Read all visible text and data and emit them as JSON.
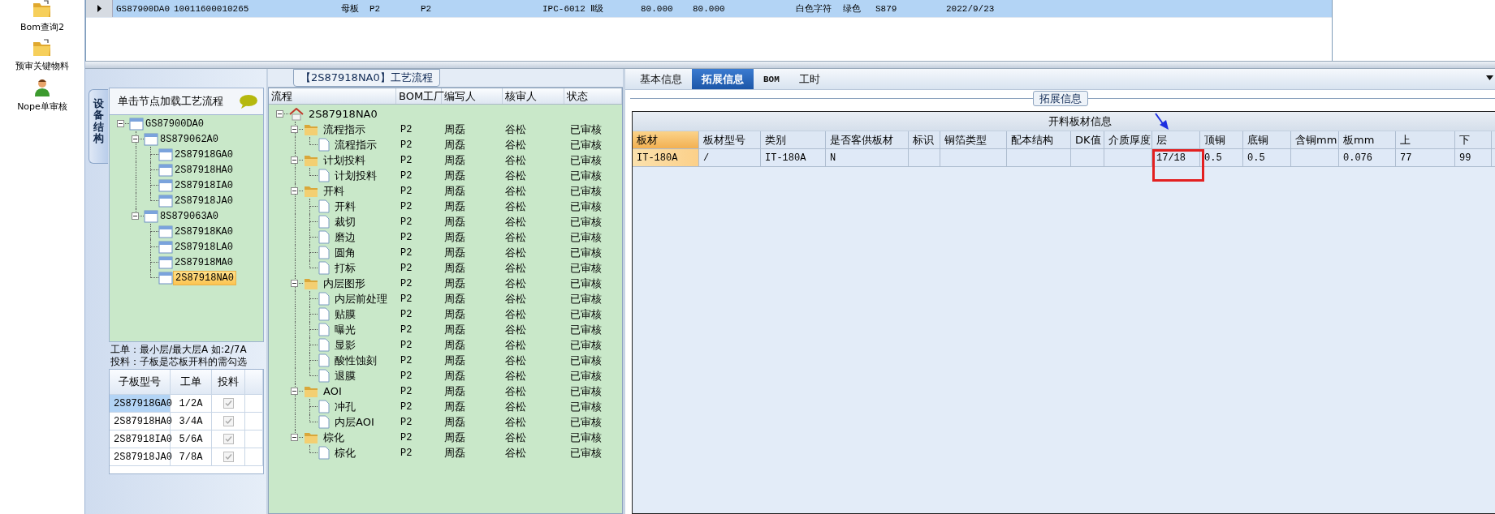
{
  "sidebar": {
    "items": [
      {
        "label": "Bom查询2",
        "kind": "folder"
      },
      {
        "label": "预审关键物料",
        "kind": "folder"
      },
      {
        "label": "Nope单审核",
        "kind": "person"
      }
    ]
  },
  "top_grid": {
    "rows": [
      {
        "selected": true,
        "cells": [
          "GS87900DA0",
          "10011600010265",
          "母板",
          "P2",
          "P2",
          "IPC-6012 Ⅱ级",
          "80.000",
          "80.000",
          "白色字符",
          "绿色",
          "S879",
          "2022/9/23"
        ]
      }
    ]
  },
  "structure_panel": {
    "vertical_tab": "设备结构",
    "hint": "单击节点加载工艺流程",
    "tree": [
      {
        "label": "GS87900DA0",
        "expanded": true,
        "selected": false,
        "children": [
          {
            "label": "8S879062A0",
            "expanded": true,
            "selected": false,
            "children": [
              {
                "label": "2S87918GA0",
                "selected": false
              },
              {
                "label": "2S87918HA0",
                "selected": false
              },
              {
                "label": "2S87918IA0",
                "selected": false
              },
              {
                "label": "2S87918JA0",
                "selected": false
              }
            ]
          },
          {
            "label": "8S879063A0",
            "expanded": true,
            "selected": false,
            "children": [
              {
                "label": "2S87918KA0",
                "selected": false
              },
              {
                "label": "2S87918LA0",
                "selected": false
              },
              {
                "label": "2S87918MA0",
                "selected": false
              },
              {
                "label": "2S87918NA0",
                "selected": true
              }
            ]
          }
        ]
      }
    ],
    "notes": [
      "工单：最小层/最大层A 如:2/7A",
      "投料：子板是芯板开料的需勾选"
    ],
    "table": {
      "columns": [
        "子板型号",
        "工单",
        "投料"
      ],
      "rows": [
        {
          "board": "2S87918GA0",
          "order": "1/2A",
          "checked": true,
          "selected": true
        },
        {
          "board": "2S87918HA0",
          "order": "3/4A",
          "checked": true,
          "selected": false
        },
        {
          "board": "2S87918IA0",
          "order": "5/6A",
          "checked": true,
          "selected": false
        },
        {
          "board": "2S87918JA0",
          "order": "7/8A",
          "checked": true,
          "selected": false
        }
      ]
    }
  },
  "process_panel": {
    "title": "【2S87918NA0】工艺流程",
    "columns": [
      "流程",
      "BOM工厂",
      "编写人",
      "核审人",
      "状态"
    ],
    "tree": [
      {
        "label": "2S87918NA0",
        "kind": "root",
        "expanded": true,
        "children": [
          {
            "label": "流程指示",
            "kind": "group",
            "expanded": true,
            "factory": "P2",
            "writer": "周磊",
            "reviewer": "谷松",
            "status": "已审核",
            "children": [
              {
                "label": "流程指示",
                "kind": "step",
                "factory": "P2",
                "writer": "周磊",
                "reviewer": "谷松",
                "status": "已审核"
              }
            ]
          },
          {
            "label": "计划投料",
            "kind": "group",
            "expanded": true,
            "factory": "P2",
            "writer": "周磊",
            "reviewer": "谷松",
            "status": "已审核",
            "children": [
              {
                "label": "计划投料",
                "kind": "step",
                "factory": "P2",
                "writer": "周磊",
                "reviewer": "谷松",
                "status": "已审核"
              }
            ]
          },
          {
            "label": "开料",
            "kind": "group",
            "expanded": true,
            "factory": "P2",
            "writer": "周磊",
            "reviewer": "谷松",
            "status": "已审核",
            "children": [
              {
                "label": "开料",
                "kind": "step",
                "factory": "P2",
                "writer": "周磊",
                "reviewer": "谷松",
                "status": "已审核"
              },
              {
                "label": "裁切",
                "kind": "step",
                "factory": "P2",
                "writer": "周磊",
                "reviewer": "谷松",
                "status": "已审核"
              },
              {
                "label": "磨边",
                "kind": "step",
                "factory": "P2",
                "writer": "周磊",
                "reviewer": "谷松",
                "status": "已审核"
              },
              {
                "label": "圆角",
                "kind": "step",
                "factory": "P2",
                "writer": "周磊",
                "reviewer": "谷松",
                "status": "已审核"
              },
              {
                "label": "打标",
                "kind": "step",
                "factory": "P2",
                "writer": "周磊",
                "reviewer": "谷松",
                "status": "已审核"
              }
            ]
          },
          {
            "label": "内层图形",
            "kind": "group",
            "expanded": true,
            "factory": "P2",
            "writer": "周磊",
            "reviewer": "谷松",
            "status": "已审核",
            "children": [
              {
                "label": "内层前处理",
                "kind": "step",
                "factory": "P2",
                "writer": "周磊",
                "reviewer": "谷松",
                "status": "已审核"
              },
              {
                "label": "贴膜",
                "kind": "step",
                "factory": "P2",
                "writer": "周磊",
                "reviewer": "谷松",
                "status": "已审核"
              },
              {
                "label": "曝光",
                "kind": "step",
                "factory": "P2",
                "writer": "周磊",
                "reviewer": "谷松",
                "status": "已审核"
              },
              {
                "label": "显影",
                "kind": "step",
                "factory": "P2",
                "writer": "周磊",
                "reviewer": "谷松",
                "status": "已审核"
              },
              {
                "label": "酸性蚀刻",
                "kind": "step",
                "factory": "P2",
                "writer": "周磊",
                "reviewer": "谷松",
                "status": "已审核"
              },
              {
                "label": "退膜",
                "kind": "step",
                "factory": "P2",
                "writer": "周磊",
                "reviewer": "谷松",
                "status": "已审核"
              }
            ]
          },
          {
            "label": "AOI",
            "kind": "group",
            "expanded": true,
            "factory": "P2",
            "writer": "周磊",
            "reviewer": "谷松",
            "status": "已审核",
            "children": [
              {
                "label": "冲孔",
                "kind": "step",
                "factory": "P2",
                "writer": "周磊",
                "reviewer": "谷松",
                "status": "已审核"
              },
              {
                "label": "内层AOI",
                "kind": "step",
                "factory": "P2",
                "writer": "周磊",
                "reviewer": "谷松",
                "status": "已审核"
              }
            ]
          },
          {
            "label": "棕化",
            "kind": "group",
            "expanded": true,
            "factory": "P2",
            "writer": "周磊",
            "reviewer": "谷松",
            "status": "已审核",
            "children": [
              {
                "label": "棕化",
                "kind": "step",
                "factory": "P2",
                "writer": "周磊",
                "reviewer": "谷松",
                "status": "已审核"
              }
            ]
          }
        ]
      }
    ]
  },
  "detail_panel": {
    "tabs": [
      {
        "label": "基本信息",
        "selected": false
      },
      {
        "label": "拓展信息",
        "selected": true
      },
      {
        "label": "BOM",
        "selected": false
      },
      {
        "label": "工时",
        "selected": false
      }
    ],
    "group_title": "拓展信息",
    "table": {
      "title": "开料板材信息",
      "columns": [
        {
          "header": "板材",
          "value": "IT-180A",
          "selected": true
        },
        {
          "header": "板材型号",
          "value": "/",
          "selected": false
        },
        {
          "header": "类别",
          "value": "IT-180A",
          "selected": false
        },
        {
          "header": "是否客供板材",
          "value": "N",
          "selected": false
        },
        {
          "header": "标识",
          "selected": false
        },
        {
          "header": "铜箔类型",
          "selected": false
        },
        {
          "header": "配本结构",
          "selected": false
        },
        {
          "header": "DK值",
          "selected": false
        },
        {
          "header": "介质厚度",
          "selected": false
        },
        {
          "header": "层",
          "value": "17/18",
          "selected": false
        },
        {
          "header": "顶铜",
          "value": "0.5",
          "selected": false
        },
        {
          "header": "底铜",
          "value": "0.5",
          "selected": false
        },
        {
          "header": "含铜mm",
          "selected": false
        },
        {
          "header": "板mm",
          "value": "0.076",
          "selected": false
        },
        {
          "header": "上",
          "value": "77",
          "selected": false
        },
        {
          "header": "下",
          "value": "99",
          "selected": false
        }
      ]
    }
  }
}
